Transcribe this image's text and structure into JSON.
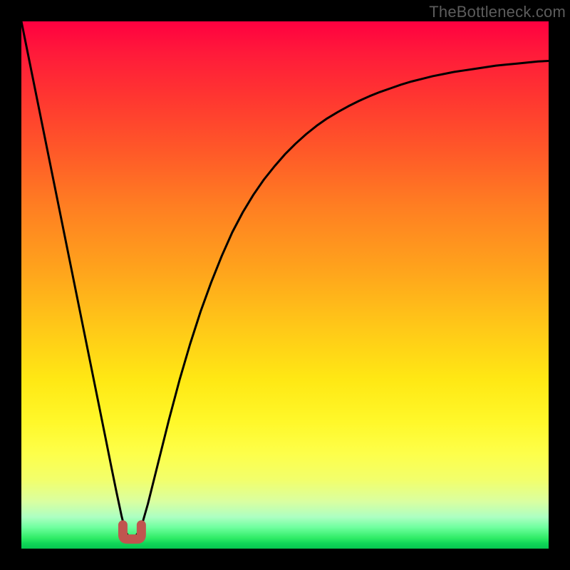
{
  "watermark": "TheBottleneck.com",
  "colors": {
    "frame": "#000000",
    "curve": "#000000",
    "marker_fill": "#c0554f",
    "marker_stroke": "#c0554f"
  },
  "chart_data": {
    "type": "line",
    "title": "",
    "xlabel": "",
    "ylabel": "",
    "xlim": [
      0,
      1
    ],
    "ylim": [
      0,
      1
    ],
    "x": [
      0.0,
      0.02,
      0.04,
      0.06,
      0.08,
      0.1,
      0.12,
      0.14,
      0.16,
      0.17,
      0.18,
      0.19,
      0.195,
      0.2,
      0.205,
      0.21,
      0.215,
      0.22,
      0.23,
      0.24,
      0.26,
      0.28,
      0.3,
      0.32,
      0.34,
      0.36,
      0.38,
      0.4,
      0.42,
      0.44,
      0.46,
      0.48,
      0.5,
      0.52,
      0.54,
      0.56,
      0.58,
      0.6,
      0.62,
      0.64,
      0.66,
      0.68,
      0.7,
      0.72,
      0.74,
      0.76,
      0.78,
      0.8,
      0.82,
      0.84,
      0.86,
      0.88,
      0.9,
      0.92,
      0.94,
      0.96,
      0.98,
      1.0
    ],
    "values": [
      1.0,
      0.901,
      0.802,
      0.703,
      0.604,
      0.505,
      0.406,
      0.307,
      0.208,
      0.158,
      0.109,
      0.062,
      0.042,
      0.028,
      0.021,
      0.02,
      0.022,
      0.028,
      0.05,
      0.085,
      0.165,
      0.245,
      0.32,
      0.388,
      0.45,
      0.505,
      0.555,
      0.6,
      0.638,
      0.671,
      0.7,
      0.725,
      0.748,
      0.768,
      0.786,
      0.802,
      0.816,
      0.828,
      0.839,
      0.849,
      0.858,
      0.866,
      0.873,
      0.88,
      0.886,
      0.891,
      0.896,
      0.9,
      0.904,
      0.907,
      0.91,
      0.913,
      0.916,
      0.918,
      0.92,
      0.922,
      0.924,
      0.925
    ],
    "minimum_marker": {
      "x": 0.21,
      "y": 0.02,
      "shape": "u",
      "width": 0.035
    },
    "annotations": []
  }
}
